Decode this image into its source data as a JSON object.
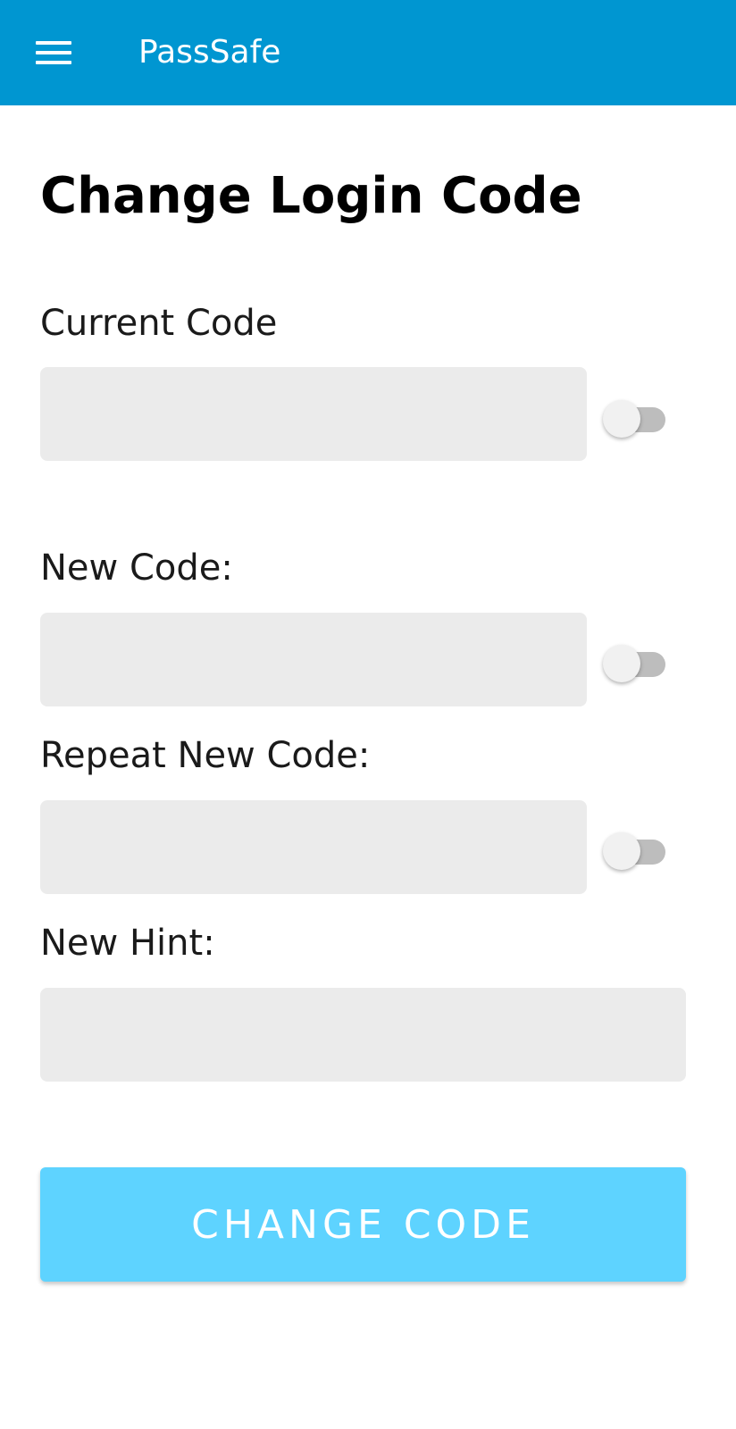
{
  "app_bar": {
    "title": "PassSafe",
    "menu_icon": "hamburger-menu-icon",
    "color": "#0096d1"
  },
  "page": {
    "title": "Change Login Code"
  },
  "fields": {
    "current_code": {
      "label": "Current Code",
      "value": "",
      "show_toggle": false
    },
    "new_code": {
      "label": "New Code:",
      "value": "",
      "show_toggle": false
    },
    "repeat_new_code": {
      "label": "Repeat New Code:",
      "value": "",
      "show_toggle": false
    },
    "new_hint": {
      "label": "New Hint:",
      "value": ""
    }
  },
  "actions": {
    "change_code_label": "CHANGE CODE",
    "button_color": "#5ed3ff"
  }
}
